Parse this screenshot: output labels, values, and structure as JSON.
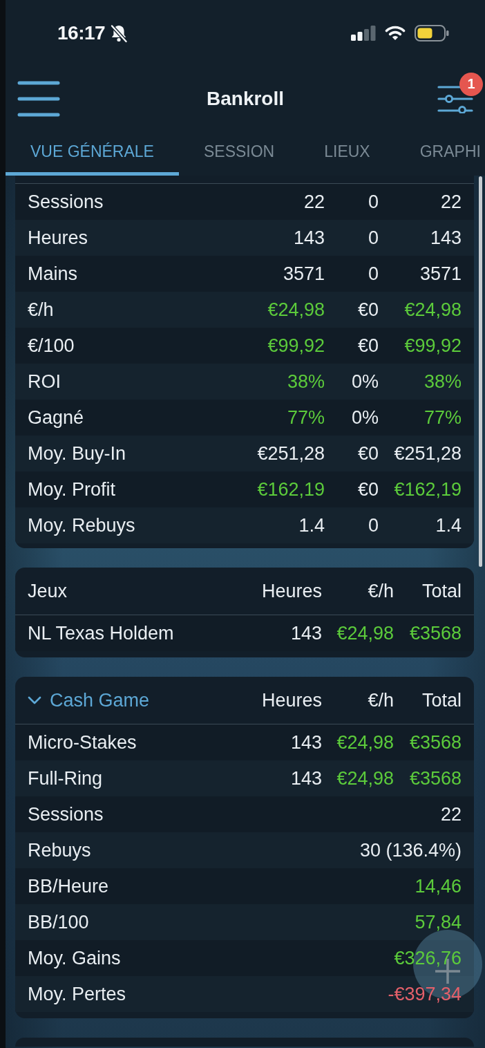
{
  "status_bar": {
    "time": "16:17"
  },
  "header": {
    "title": "Bankroll",
    "filter_badge": "1"
  },
  "tabs": [
    {
      "label": "VUE GÉNÉRALE",
      "selected": true
    },
    {
      "label": "SESSION",
      "selected": false
    },
    {
      "label": "LIEUX",
      "selected": false
    },
    {
      "label": "GRAPHI",
      "selected": false
    }
  ],
  "overview": {
    "rows": [
      {
        "label": "Sessions",
        "values": [
          {
            "text": "22",
            "color": "#e9eef2"
          },
          {
            "text": "0",
            "color": "#e9eef2"
          },
          {
            "text": "22",
            "color": "#e9eef2"
          }
        ]
      },
      {
        "label": "Heures",
        "values": [
          {
            "text": "143",
            "color": "#e9eef2"
          },
          {
            "text": "0",
            "color": "#e9eef2"
          },
          {
            "text": "143",
            "color": "#e9eef2"
          }
        ]
      },
      {
        "label": "Mains",
        "values": [
          {
            "text": "3571",
            "color": "#e9eef2"
          },
          {
            "text": "0",
            "color": "#e9eef2"
          },
          {
            "text": "3571",
            "color": "#e9eef2"
          }
        ]
      },
      {
        "label": "€/h",
        "values": [
          {
            "text": "€24,98",
            "color": "#5ccb3b"
          },
          {
            "text": "€0",
            "color": "#e9eef2"
          },
          {
            "text": "€24,98",
            "color": "#5ccb3b"
          }
        ]
      },
      {
        "label": "€/100",
        "values": [
          {
            "text": "€99,92",
            "color": "#5ccb3b"
          },
          {
            "text": "€0",
            "color": "#e9eef2"
          },
          {
            "text": "€99,92",
            "color": "#5ccb3b"
          }
        ]
      },
      {
        "label": "ROI",
        "values": [
          {
            "text": "38%",
            "color": "#5ccb3b"
          },
          {
            "text": "0%",
            "color": "#e9eef2"
          },
          {
            "text": "38%",
            "color": "#5ccb3b"
          }
        ]
      },
      {
        "label": "Gagné",
        "values": [
          {
            "text": "77%",
            "color": "#5ccb3b"
          },
          {
            "text": "0%",
            "color": "#e9eef2"
          },
          {
            "text": "77%",
            "color": "#5ccb3b"
          }
        ]
      },
      {
        "label": "Moy. Buy-In",
        "values": [
          {
            "text": "€251,28",
            "color": "#e9eef2"
          },
          {
            "text": "€0",
            "color": "#e9eef2"
          },
          {
            "text": "€251,28",
            "color": "#e9eef2"
          }
        ]
      },
      {
        "label": "Moy. Profit",
        "values": [
          {
            "text": "€162,19",
            "color": "#5ccb3b"
          },
          {
            "text": "€0",
            "color": "#e9eef2"
          },
          {
            "text": "€162,19",
            "color": "#5ccb3b"
          }
        ]
      },
      {
        "label": "Moy. Rebuys",
        "values": [
          {
            "text": "1.4",
            "color": "#e9eef2"
          },
          {
            "text": "0",
            "color": "#e9eef2"
          },
          {
            "text": "1.4",
            "color": "#e9eef2"
          }
        ]
      }
    ]
  },
  "games": {
    "columns": [
      "Jeux",
      "Heures",
      "€/h",
      "Total"
    ],
    "rows": [
      {
        "label": "NL Texas Holdem",
        "values": [
          {
            "text": "143",
            "color": "#e9eef2"
          },
          {
            "text": "€24,98",
            "color": "#5ccb3b"
          },
          {
            "text": "€3568",
            "color": "#5ccb3b"
          }
        ]
      }
    ]
  },
  "cash_game": {
    "title": "Cash Game",
    "expanded": true,
    "columns": [
      "Heures",
      "€/h",
      "Total"
    ],
    "rows": [
      {
        "label": "Micro-Stakes",
        "values": [
          {
            "text": "143",
            "color": "#e9eef2"
          },
          {
            "text": "€24,98",
            "color": "#5ccb3b"
          },
          {
            "text": "€3568",
            "color": "#5ccb3b"
          }
        ]
      },
      {
        "label": "Full-Ring",
        "values": [
          {
            "text": "143",
            "color": "#e9eef2"
          },
          {
            "text": "€24,98",
            "color": "#5ccb3b"
          },
          {
            "text": "€3568",
            "color": "#5ccb3b"
          }
        ]
      }
    ],
    "stats": [
      {
        "label": "Sessions",
        "value": "22",
        "color": "#e9eef2"
      },
      {
        "label": "Rebuys",
        "value": "30 (136.4%)",
        "color": "#e9eef2"
      },
      {
        "label": "BB/Heure",
        "value": "14,46",
        "color": "#5ccb3b"
      },
      {
        "label": "BB/100",
        "value": "57,84",
        "color": "#5ccb3b"
      },
      {
        "label": "Moy. Gains",
        "value": "€326,76",
        "color": "#5ccb3b"
      },
      {
        "label": "Moy. Pertes",
        "value": "-€397,34",
        "color": "#e4606a"
      }
    ]
  }
}
